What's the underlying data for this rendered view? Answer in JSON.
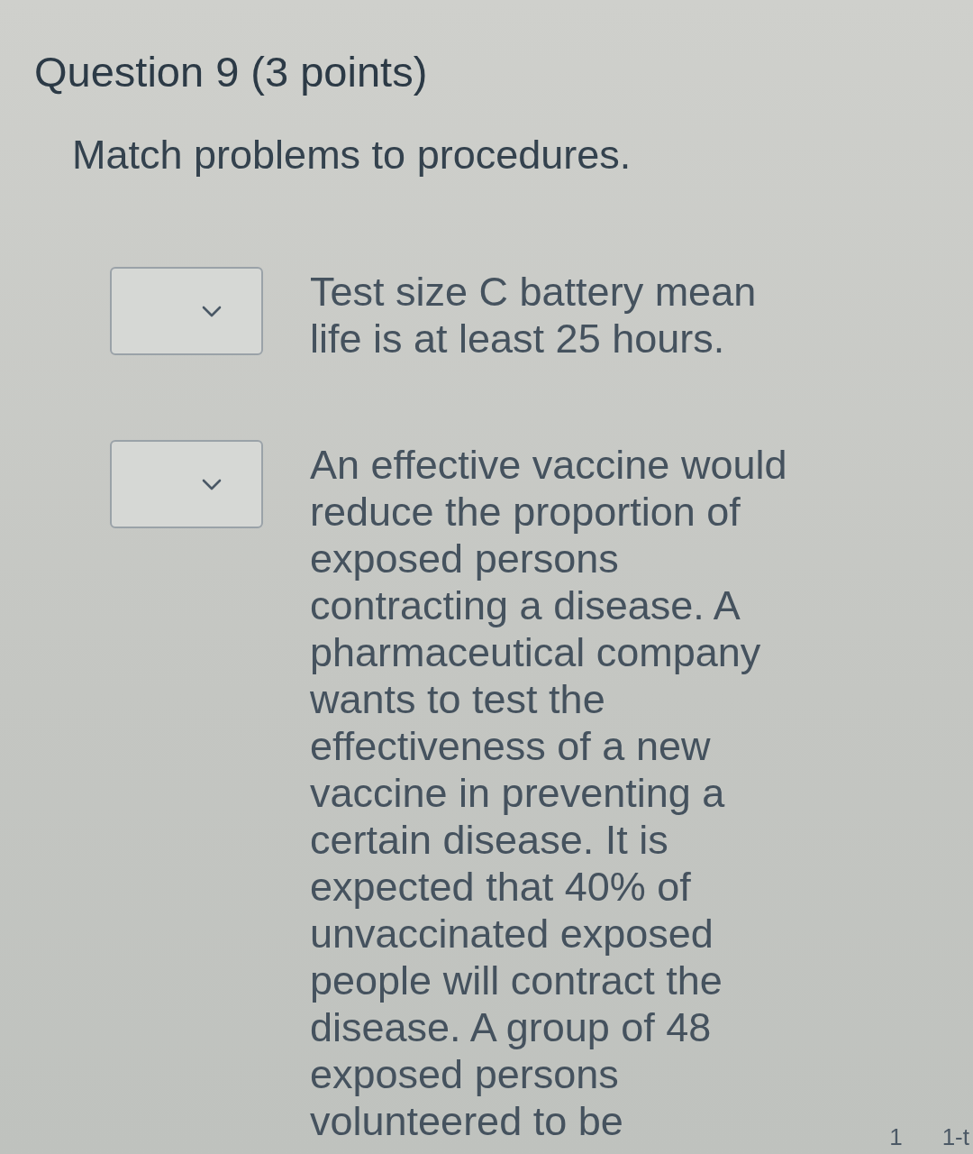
{
  "question": {
    "title": "Question 9 (3 points)",
    "instructions": "Match problems to procedures."
  },
  "matches": [
    {
      "problem": "Test size C battery mean life is at least 25 hours."
    },
    {
      "problem": "An effective vaccine would reduce the proportion of exposed persons contracting a disease. A pharmaceutical company wants to test the effectiveness of a new vaccine in preventing a certain disease. It is expected that 40% of unvaccinated exposed people will contract the disease. A group of 48 exposed persons volunteered to be"
    }
  ],
  "cut_off_labels": [
    "1",
    "1-t"
  ]
}
